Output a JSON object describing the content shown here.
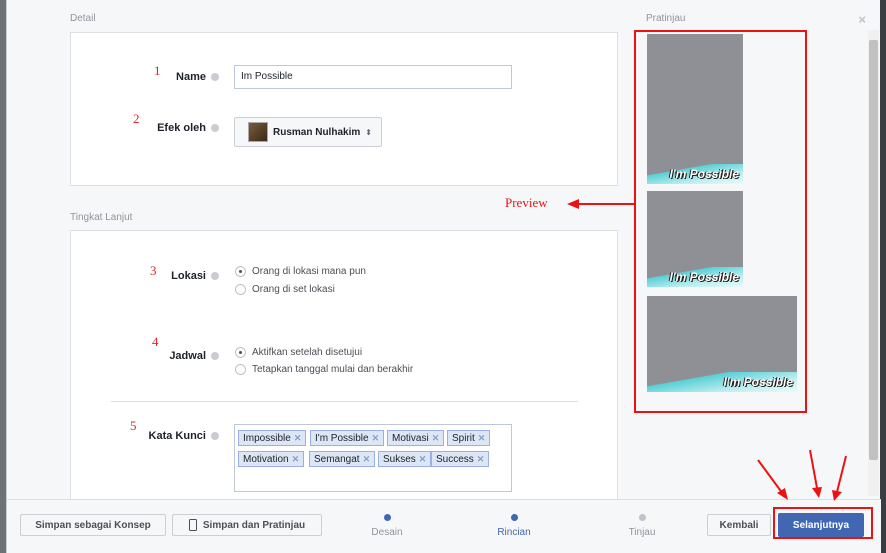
{
  "dialog": {
    "close_label": "×"
  },
  "detail": {
    "section_title": "Detail",
    "name": {
      "step": "1",
      "label": "Name",
      "value": "Im Possible"
    },
    "effect": {
      "step": "2",
      "label": "Efek oleh",
      "page_name": "Rusman Nulhakim",
      "caret": "⬍"
    }
  },
  "advanced": {
    "section_title": "Tingkat Lanjut",
    "location": {
      "step": "3",
      "label": "Lokasi",
      "options": [
        "Orang di lokasi mana pun",
        "Orang di set lokasi"
      ],
      "selected_index": 0
    },
    "schedule": {
      "step": "4",
      "label": "Jadwal",
      "options": [
        "Aktifkan setelah disetujui",
        "Tetapkan tanggal mulai dan berakhir"
      ],
      "selected_index": 0
    },
    "keywords": {
      "step": "5",
      "label": "Kata Kunci",
      "tags": [
        "Impossible",
        "I'm Possible",
        "Motivasi",
        "Spirit",
        "Motivation",
        "Semangat",
        "Sukses",
        "Success"
      ],
      "remove_glyph": "✕"
    }
  },
  "preview": {
    "section_title": "Pratinjau",
    "annotation": "Preview",
    "thumb_text": "I'm Possible"
  },
  "footer": {
    "save_draft": "Simpan sebagai Konsep",
    "save_preview": "Simpan dan Pratinjau",
    "steps": [
      {
        "label": "Desain",
        "color": "#4267b2"
      },
      {
        "label": "Rincian",
        "color": "#4267b2"
      },
      {
        "label": "Tinjau",
        "color": "#bec3c9"
      }
    ],
    "back": "Kembali",
    "next": "Selanjutnya"
  },
  "colors": {
    "accent": "#4267b2",
    "annotation": "#ee1111"
  }
}
